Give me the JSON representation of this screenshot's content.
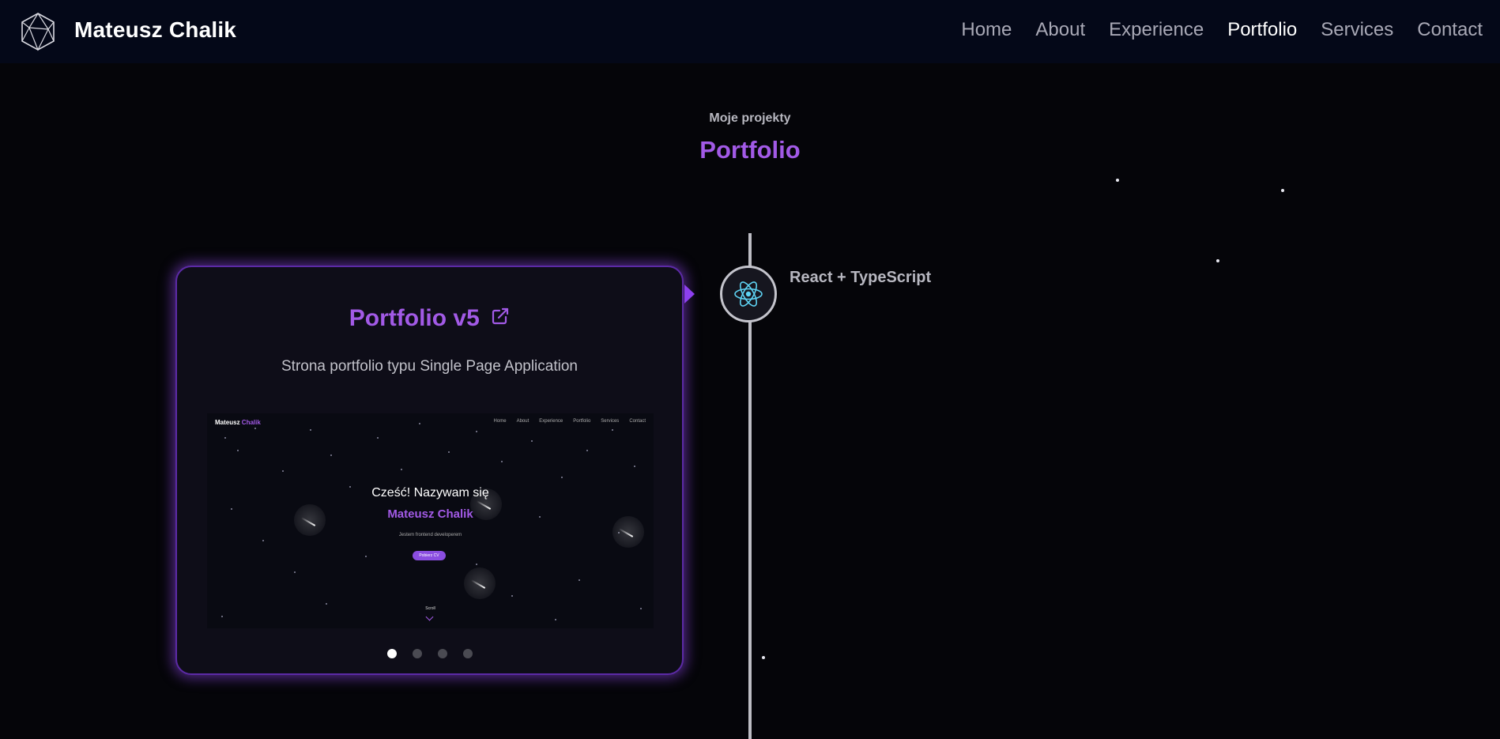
{
  "navbar": {
    "brand": "Mateusz Chalik",
    "links": [
      {
        "label": "Home"
      },
      {
        "label": "About"
      },
      {
        "label": "Experience"
      },
      {
        "label": "Portfolio",
        "active": true
      },
      {
        "label": "Services"
      },
      {
        "label": "Contact"
      }
    ]
  },
  "section": {
    "subtitle": "Moje projekty",
    "title": "Portfolio"
  },
  "timeline": {
    "items": [
      {
        "date_label": "React + TypeScript",
        "icon": "react-icon",
        "card": {
          "title": "Portfolio v5",
          "description": "Strona portfolio typu Single Page Application",
          "preview": {
            "brand_first": "Mateusz",
            "brand_second": "Chalik",
            "nav": [
              "Home",
              "About",
              "Experience",
              "Portfolio",
              "Services",
              "Contact"
            ],
            "greeting": "Cześć! Nazywam się",
            "name": "Mateusz Chalik",
            "subtitle": "Jestem frontend developerem",
            "button": "Pobierz CV",
            "scroll": "Scroll"
          },
          "slides": 4,
          "active_slide": 1
        }
      }
    ]
  },
  "colors": {
    "accent": "#a25ae6",
    "background": "#050509",
    "navbar": "#040818",
    "card": "#0e0d18",
    "react": "#5ed3f3"
  }
}
